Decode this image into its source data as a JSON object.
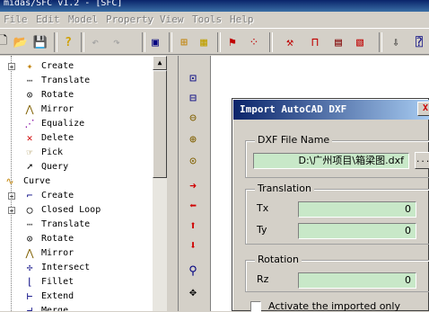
{
  "window": {
    "title": "midas/SFC v1.2 - [SFC]"
  },
  "menu": [
    "File",
    "Edit",
    "Model",
    "Property",
    "View",
    "Tools",
    "Help"
  ],
  "tree": {
    "items": [
      {
        "label": "Create",
        "icon": "create-icon",
        "indent": 2,
        "expander": "+"
      },
      {
        "label": "Translate",
        "icon": "translate-icon",
        "indent": 2
      },
      {
        "label": "Rotate",
        "icon": "rotate-icon",
        "indent": 2
      },
      {
        "label": "Mirror",
        "icon": "mirror-icon",
        "indent": 2
      },
      {
        "label": "Equalize",
        "icon": "equalize-icon",
        "indent": 2
      },
      {
        "label": "Delete",
        "icon": "delete-icon",
        "indent": 2
      },
      {
        "label": "Pick",
        "icon": "pick-icon",
        "indent": 2
      },
      {
        "label": "Query",
        "icon": "query-icon",
        "indent": 2
      },
      {
        "label": "Curve",
        "icon": "curve-icon",
        "indent": 1
      },
      {
        "label": "Create",
        "icon": "create-icon",
        "indent": 2,
        "expander": "+"
      },
      {
        "label": "Closed Loop",
        "icon": "closed-loop-icon",
        "indent": 2,
        "expander": "+"
      },
      {
        "label": "Translate",
        "icon": "translate-icon",
        "indent": 2
      },
      {
        "label": "Rotate",
        "icon": "rotate-icon",
        "indent": 2
      },
      {
        "label": "Mirror",
        "icon": "mirror-icon",
        "indent": 2
      },
      {
        "label": "Intersect",
        "icon": "intersect-icon",
        "indent": 2
      },
      {
        "label": "Fillet",
        "icon": "fillet-icon",
        "indent": 2
      },
      {
        "label": "Extend",
        "icon": "extend-icon",
        "indent": 2
      },
      {
        "label": "Merge",
        "icon": "merge-icon",
        "indent": 2
      }
    ]
  },
  "dialog": {
    "title": "Import AutoCAD DXF",
    "close": "X",
    "dxf_group": "DXF File Name",
    "dxf_path": "D:\\广州项目\\箱梁图.dxf",
    "browse": "...",
    "translation_group": "Translation",
    "tx_label": "Tx",
    "tx_value": "0",
    "ty_label": "Ty",
    "ty_value": "0",
    "rotation_group": "Rotation",
    "rz_label": "Rz",
    "rz_value": "0",
    "activate_label": "Activate the imported only"
  },
  "colors": {
    "field_bg": "#c8e8c8",
    "title_start": "#0a246a",
    "title_end": "#a6caf0"
  }
}
